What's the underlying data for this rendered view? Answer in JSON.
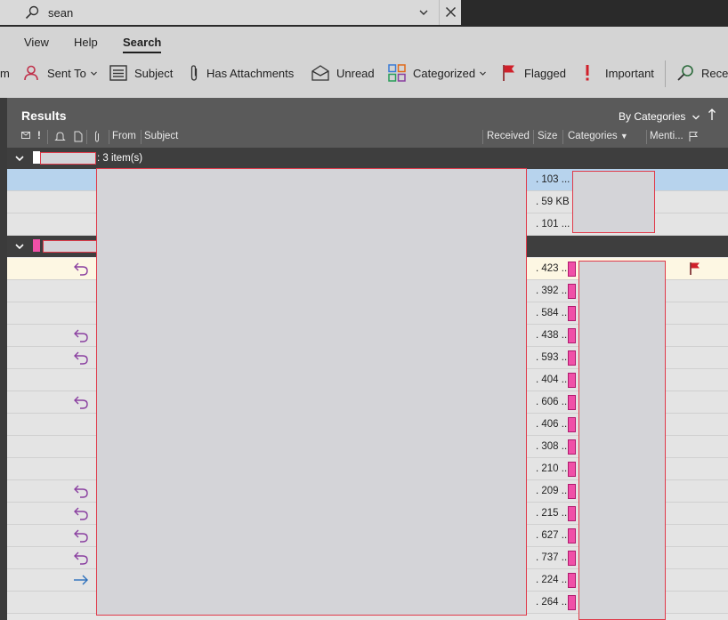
{
  "search": {
    "value": "sean"
  },
  "menu": {
    "tabs": [
      "View",
      "Help",
      "Search"
    ],
    "active": "Search"
  },
  "ribbon": {
    "partial_left": "m",
    "sent_to": "Sent To",
    "subject": "Subject",
    "has_attachments": "Has Attachments",
    "unread": "Unread",
    "categorized": "Categorized",
    "flagged": "Flagged",
    "important": "Important",
    "received": "Rece"
  },
  "results": {
    "title": "Results",
    "sort_by": "By Categories",
    "columns": {
      "from": "From",
      "subject": "Subject",
      "received": "Received",
      "size": "Size",
      "categories": "Categories",
      "mentions": "Menti..."
    }
  },
  "groups": [
    {
      "count_label": ": 3 item(s)",
      "swatch_color": "#ffffff"
    },
    {
      "count_label": "",
      "swatch_color": "#f050a8"
    }
  ],
  "rows": [
    {
      "size": ". 103 ...",
      "state": "selected",
      "icon": "",
      "category": false
    },
    {
      "size": ". 59 KB",
      "state": "",
      "icon": "",
      "category": false
    },
    {
      "size": ". 101 ...",
      "state": "",
      "icon": "",
      "category": false
    },
    {
      "size": ". 423 ...",
      "state": "flagged",
      "icon": "reply",
      "category": true,
      "flag": true
    },
    {
      "size": ". 392 ...",
      "state": "",
      "icon": "",
      "category": true
    },
    {
      "size": ". 584 ...",
      "state": "",
      "icon": "",
      "category": true
    },
    {
      "size": ". 438 ...",
      "state": "",
      "icon": "reply",
      "category": true
    },
    {
      "size": ". 593 ...",
      "state": "",
      "icon": "reply",
      "category": true
    },
    {
      "size": ". 404 ...",
      "state": "",
      "icon": "",
      "category": true
    },
    {
      "size": ". 606 ...",
      "state": "",
      "icon": "reply",
      "category": true
    },
    {
      "size": ". 406 ...",
      "state": "",
      "icon": "",
      "category": true
    },
    {
      "size": ". 308 ...",
      "state": "",
      "icon": "",
      "category": true
    },
    {
      "size": ". 210 ...",
      "state": "",
      "icon": "",
      "category": true
    },
    {
      "size": ". 209 ...",
      "state": "",
      "icon": "reply",
      "category": true
    },
    {
      "size": ". 215 ...",
      "state": "",
      "icon": "reply",
      "category": true
    },
    {
      "size": ". 627 ...",
      "state": "",
      "icon": "reply",
      "category": true
    },
    {
      "size": ". 737 ...",
      "state": "",
      "icon": "reply",
      "category": true
    },
    {
      "size": ". 224 ...",
      "state": "",
      "icon": "forward",
      "category": true
    },
    {
      "size": ". 264 ...",
      "state": "",
      "icon": "",
      "category": true
    }
  ],
  "colors": {
    "accent_category": "#f050a8",
    "reply_icon": "#8a3fa0",
    "forward_icon": "#2a6ebb",
    "flag": "#d0202a",
    "selected_row": "#b7d3ed"
  }
}
